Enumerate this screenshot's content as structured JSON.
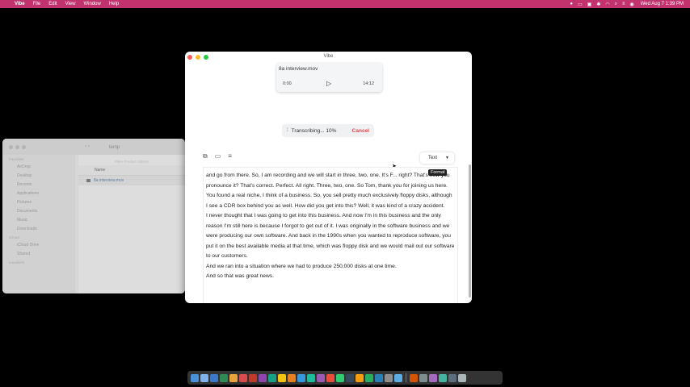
{
  "menubar": {
    "app_name": "Vibe",
    "menus": [
      "File",
      "Edit",
      "View",
      "Window",
      "Help"
    ],
    "clock": "Wed Aug 7 1:39 PM"
  },
  "finder": {
    "folder_name": "temp",
    "hint": "Files Product Videos",
    "column_name": "Name",
    "file_name": "8a interview.mov",
    "sidebar": {
      "favorites_label": "Favorites",
      "favorites": [
        "AirDrop",
        "Desktop",
        "Recents",
        "Applications",
        "Pictures",
        "Documents",
        "Music",
        "Downloads"
      ],
      "cloud_label": "iCloud",
      "cloud": [
        "iCloud Drive",
        "Shared"
      ],
      "locations_label": "Locations"
    }
  },
  "window": {
    "title": "Vibe"
  },
  "player": {
    "file_name": "8a interview.mov",
    "current_time": "0:00",
    "duration": "14:12"
  },
  "transcribe": {
    "status": "Transcribing... 10%",
    "cancel_label": "Cancel"
  },
  "format": {
    "value": "Text",
    "tooltip": "Format"
  },
  "transcript": {
    "paragraphs": [
      "and go from there. So, I am recording and we will start in three, two, one. It's F... right? That's how you pronounce it? That's correct. Perfect. All right. Three, two, one. So Tom, thank you for joining us here. You found a real niche, I think of a business. So, you sell pretty much exclusively floppy disks, although I see a CDR box behind you as well. How did you get into this? Well, it was kind of a crazy accident.",
      "I never thought that I was going to get into this business. And now I'm in this business and the only reason I'm still here is because I forgot to get out of it. I was originally in the software business and we were producing our own software. And back in the 1990s when you wanted to reproduce software, you put it on the best available media at that time, which was floppy disk and we would mail out our software to our customers.",
      "And we ran into a situation where we had to produce 250,000 disks at one time.",
      "And so that was great news."
    ]
  },
  "dock": {
    "colors": [
      "#4a90d9",
      "#7fb0e8",
      "#3c78c8",
      "#2e8b57",
      "#e8a33c",
      "#d94a4a",
      "#c0392b",
      "#8e44ad",
      "#16a085",
      "#f1c40f",
      "#e67e22",
      "#3498db",
      "#1abc9c",
      "#9b59b6",
      "#e74c3c",
      "#2ecc71",
      "#34495e",
      "#f39c12",
      "#27ae60",
      "#2980b9",
      "#8e8e8e",
      "#5dade2",
      "#d35400",
      "#7f8c8d",
      "#a569bd",
      "#45b39d",
      "#5d6d7e",
      "#aab7b8"
    ]
  }
}
